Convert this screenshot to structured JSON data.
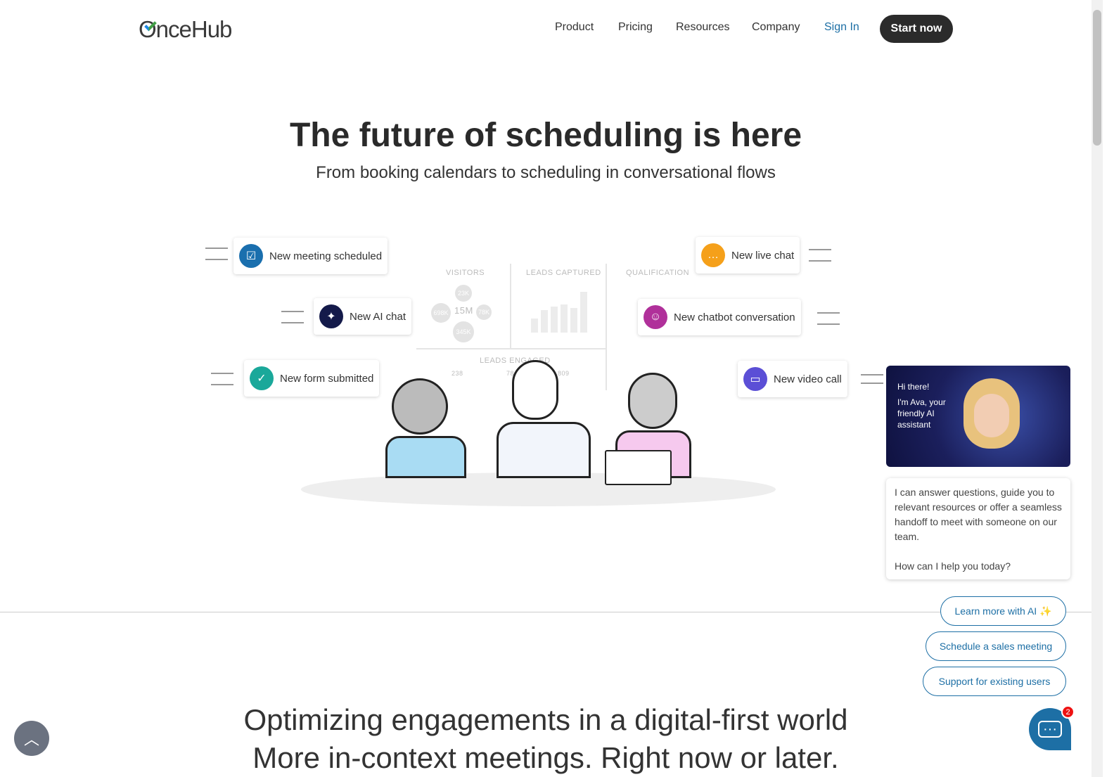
{
  "header": {
    "logo": "OnceHub",
    "nav": [
      "Product",
      "Pricing",
      "Resources",
      "Company"
    ],
    "sign_in": "Sign In",
    "start_now": "Start now"
  },
  "hero": {
    "title": "The future of scheduling is here",
    "subtitle": "From booking calendars to scheduling in conversational flows"
  },
  "notifications": [
    {
      "label": "New meeting scheduled",
      "icon": "calendar-check-icon",
      "color": "#1a6fae"
    },
    {
      "label": "New AI chat",
      "icon": "sparkle-icon",
      "color": "#141a4a"
    },
    {
      "label": "New form submitted",
      "icon": "form-check-icon",
      "color": "#1aa89a"
    },
    {
      "label": "New live chat",
      "icon": "chat-bubble-icon",
      "color": "#f5a01a"
    },
    {
      "label": "New chatbot conversation",
      "icon": "robot-icon",
      "color": "#b0309a"
    },
    {
      "label": "New video call",
      "icon": "video-camera-icon",
      "color": "#5b4fd6"
    }
  ],
  "dashboard": {
    "visitors": "VISITORS",
    "leads_captured": "LEADS CAPTURED",
    "qualification": "QUALIFICATION",
    "leads_engaged": "LEADS ENGAGED",
    "total": "15M",
    "bubbles": [
      "23K",
      "698K",
      "78K",
      "345K"
    ],
    "engaged_values": [
      "238",
      "78",
      "809"
    ]
  },
  "assistant": {
    "greeting": "Hi there!",
    "intro": "I'm Ava, your friendly AI assistant",
    "message": "I can answer questions, guide you to relevant resources or offer a seamless handoff to meet with someone on our team.",
    "question": "How can I help you today?",
    "options": [
      "Learn more with AI ✨",
      "Schedule a sales meeting",
      "Support for existing users"
    ],
    "unread": "2"
  },
  "section": {
    "line1": "Optimizing engagements in a digital-first world",
    "line2": "More in-context meetings. Right now or later."
  }
}
